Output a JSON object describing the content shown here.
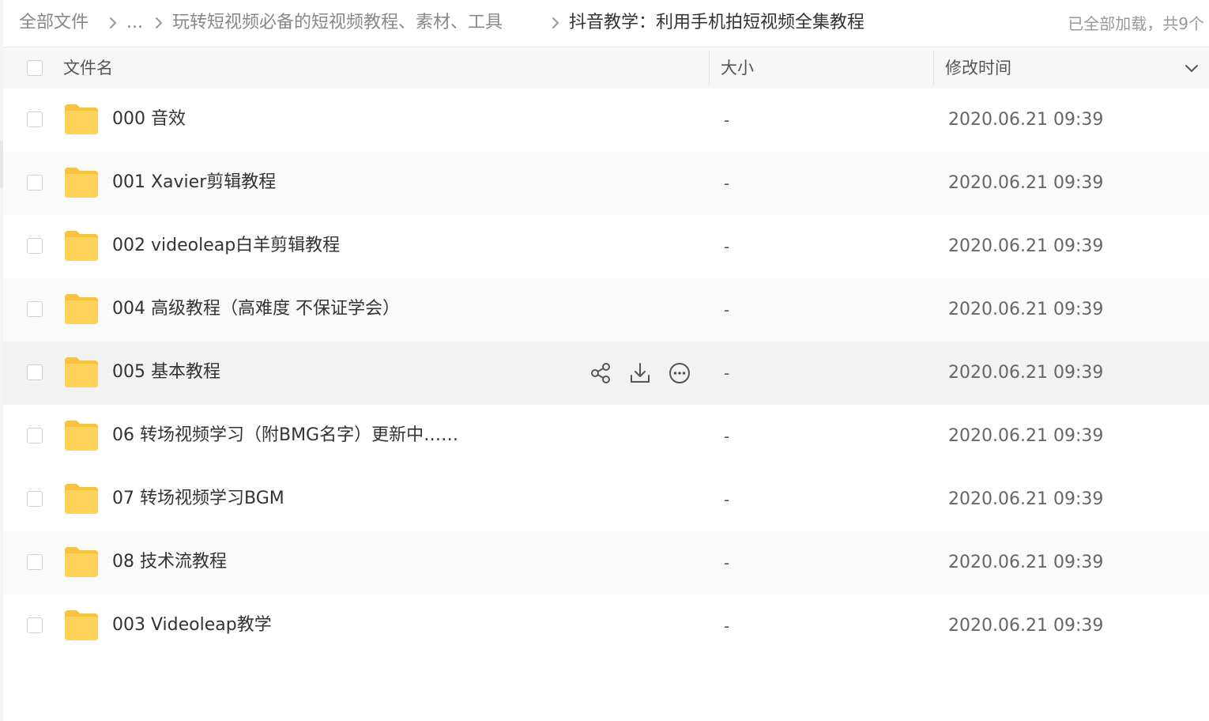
{
  "breadcrumb": {
    "root": "全部文件",
    "ellipsis": "...",
    "parent": "玩转短视频必备的短视频教程、素材、工具",
    "current": "抖音教学：利用手机拍短视频全集教程"
  },
  "load_status": "已全部加载，共9个",
  "header": {
    "name": "文件名",
    "size": "大小",
    "modified": "修改时间"
  },
  "rows": [
    {
      "name": "000 音效",
      "size": "-",
      "modified": "2020.06.21 09:39"
    },
    {
      "name": "001 Xavier剪辑教程",
      "size": "-",
      "modified": "2020.06.21 09:39"
    },
    {
      "name": "002 videoleap白羊剪辑教程",
      "size": "-",
      "modified": "2020.06.21 09:39"
    },
    {
      "name": "004 高级教程（高难度 不保证学会）",
      "size": "-",
      "modified": "2020.06.21 09:39"
    },
    {
      "name": "005 基本教程",
      "size": "-",
      "modified": "2020.06.21 09:39"
    },
    {
      "name": "06 转场视频学习（附BMG名字）更新中……",
      "size": "-",
      "modified": "2020.06.21 09:39"
    },
    {
      "name": "07 转场视频学习BGM",
      "size": "-",
      "modified": "2020.06.21 09:39"
    },
    {
      "name": "08 技术流教程",
      "size": "-",
      "modified": "2020.06.21 09:39"
    },
    {
      "name": "003 Videoleap教学",
      "size": "-",
      "modified": "2020.06.21 09:39"
    }
  ],
  "hovered_row_actions": [
    "share-icon",
    "download-icon",
    "more-icon"
  ],
  "colors": {
    "folder": "#FFD25A",
    "folder_back": "#F7C343",
    "hover_row": "#F2F2F2",
    "alt_row": "#FAFAFA"
  }
}
